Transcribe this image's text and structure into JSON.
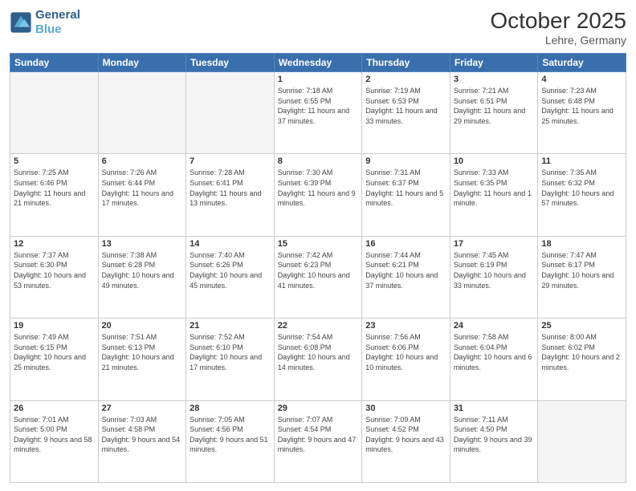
{
  "header": {
    "logo_line1": "General",
    "logo_line2": "Blue",
    "month": "October 2025",
    "location": "Lehre, Germany"
  },
  "weekdays": [
    "Sunday",
    "Monday",
    "Tuesday",
    "Wednesday",
    "Thursday",
    "Friday",
    "Saturday"
  ],
  "weeks": [
    [
      {
        "day": "",
        "sunrise": "",
        "sunset": "",
        "daylight": "",
        "empty": true
      },
      {
        "day": "",
        "sunrise": "",
        "sunset": "",
        "daylight": "",
        "empty": true
      },
      {
        "day": "",
        "sunrise": "",
        "sunset": "",
        "daylight": "",
        "empty": true
      },
      {
        "day": "1",
        "sunrise": "Sunrise: 7:18 AM",
        "sunset": "Sunset: 6:55 PM",
        "daylight": "Daylight: 11 hours and 37 minutes."
      },
      {
        "day": "2",
        "sunrise": "Sunrise: 7:19 AM",
        "sunset": "Sunset: 6:53 PM",
        "daylight": "Daylight: 11 hours and 33 minutes."
      },
      {
        "day": "3",
        "sunrise": "Sunrise: 7:21 AM",
        "sunset": "Sunset: 6:51 PM",
        "daylight": "Daylight: 11 hours and 29 minutes."
      },
      {
        "day": "4",
        "sunrise": "Sunrise: 7:23 AM",
        "sunset": "Sunset: 6:48 PM",
        "daylight": "Daylight: 11 hours and 25 minutes."
      }
    ],
    [
      {
        "day": "5",
        "sunrise": "Sunrise: 7:25 AM",
        "sunset": "Sunset: 6:46 PM",
        "daylight": "Daylight: 11 hours and 21 minutes."
      },
      {
        "day": "6",
        "sunrise": "Sunrise: 7:26 AM",
        "sunset": "Sunset: 6:44 PM",
        "daylight": "Daylight: 11 hours and 17 minutes."
      },
      {
        "day": "7",
        "sunrise": "Sunrise: 7:28 AM",
        "sunset": "Sunset: 6:41 PM",
        "daylight": "Daylight: 11 hours and 13 minutes."
      },
      {
        "day": "8",
        "sunrise": "Sunrise: 7:30 AM",
        "sunset": "Sunset: 6:39 PM",
        "daylight": "Daylight: 11 hours and 9 minutes."
      },
      {
        "day": "9",
        "sunrise": "Sunrise: 7:31 AM",
        "sunset": "Sunset: 6:37 PM",
        "daylight": "Daylight: 11 hours and 5 minutes."
      },
      {
        "day": "10",
        "sunrise": "Sunrise: 7:33 AM",
        "sunset": "Sunset: 6:35 PM",
        "daylight": "Daylight: 11 hours and 1 minute."
      },
      {
        "day": "11",
        "sunrise": "Sunrise: 7:35 AM",
        "sunset": "Sunset: 6:32 PM",
        "daylight": "Daylight: 10 hours and 57 minutes."
      }
    ],
    [
      {
        "day": "12",
        "sunrise": "Sunrise: 7:37 AM",
        "sunset": "Sunset: 6:30 PM",
        "daylight": "Daylight: 10 hours and 53 minutes."
      },
      {
        "day": "13",
        "sunrise": "Sunrise: 7:38 AM",
        "sunset": "Sunset: 6:28 PM",
        "daylight": "Daylight: 10 hours and 49 minutes."
      },
      {
        "day": "14",
        "sunrise": "Sunrise: 7:40 AM",
        "sunset": "Sunset: 6:26 PM",
        "daylight": "Daylight: 10 hours and 45 minutes."
      },
      {
        "day": "15",
        "sunrise": "Sunrise: 7:42 AM",
        "sunset": "Sunset: 6:23 PM",
        "daylight": "Daylight: 10 hours and 41 minutes."
      },
      {
        "day": "16",
        "sunrise": "Sunrise: 7:44 AM",
        "sunset": "Sunset: 6:21 PM",
        "daylight": "Daylight: 10 hours and 37 minutes."
      },
      {
        "day": "17",
        "sunrise": "Sunrise: 7:45 AM",
        "sunset": "Sunset: 6:19 PM",
        "daylight": "Daylight: 10 hours and 33 minutes."
      },
      {
        "day": "18",
        "sunrise": "Sunrise: 7:47 AM",
        "sunset": "Sunset: 6:17 PM",
        "daylight": "Daylight: 10 hours and 29 minutes."
      }
    ],
    [
      {
        "day": "19",
        "sunrise": "Sunrise: 7:49 AM",
        "sunset": "Sunset: 6:15 PM",
        "daylight": "Daylight: 10 hours and 25 minutes."
      },
      {
        "day": "20",
        "sunrise": "Sunrise: 7:51 AM",
        "sunset": "Sunset: 6:13 PM",
        "daylight": "Daylight: 10 hours and 21 minutes."
      },
      {
        "day": "21",
        "sunrise": "Sunrise: 7:52 AM",
        "sunset": "Sunset: 6:10 PM",
        "daylight": "Daylight: 10 hours and 17 minutes."
      },
      {
        "day": "22",
        "sunrise": "Sunrise: 7:54 AM",
        "sunset": "Sunset: 6:08 PM",
        "daylight": "Daylight: 10 hours and 14 minutes."
      },
      {
        "day": "23",
        "sunrise": "Sunrise: 7:56 AM",
        "sunset": "Sunset: 6:06 PM",
        "daylight": "Daylight: 10 hours and 10 minutes."
      },
      {
        "day": "24",
        "sunrise": "Sunrise: 7:58 AM",
        "sunset": "Sunset: 6:04 PM",
        "daylight": "Daylight: 10 hours and 6 minutes."
      },
      {
        "day": "25",
        "sunrise": "Sunrise: 8:00 AM",
        "sunset": "Sunset: 6:02 PM",
        "daylight": "Daylight: 10 hours and 2 minutes."
      }
    ],
    [
      {
        "day": "26",
        "sunrise": "Sunrise: 7:01 AM",
        "sunset": "Sunset: 5:00 PM",
        "daylight": "Daylight: 9 hours and 58 minutes."
      },
      {
        "day": "27",
        "sunrise": "Sunrise: 7:03 AM",
        "sunset": "Sunset: 4:58 PM",
        "daylight": "Daylight: 9 hours and 54 minutes."
      },
      {
        "day": "28",
        "sunrise": "Sunrise: 7:05 AM",
        "sunset": "Sunset: 4:56 PM",
        "daylight": "Daylight: 9 hours and 51 minutes."
      },
      {
        "day": "29",
        "sunrise": "Sunrise: 7:07 AM",
        "sunset": "Sunset: 4:54 PM",
        "daylight": "Daylight: 9 hours and 47 minutes."
      },
      {
        "day": "30",
        "sunrise": "Sunrise: 7:09 AM",
        "sunset": "Sunset: 4:52 PM",
        "daylight": "Daylight: 9 hours and 43 minutes."
      },
      {
        "day": "31",
        "sunrise": "Sunrise: 7:11 AM",
        "sunset": "Sunset: 4:50 PM",
        "daylight": "Daylight: 9 hours and 39 minutes."
      },
      {
        "day": "",
        "sunrise": "",
        "sunset": "",
        "daylight": "",
        "empty": true
      }
    ]
  ]
}
